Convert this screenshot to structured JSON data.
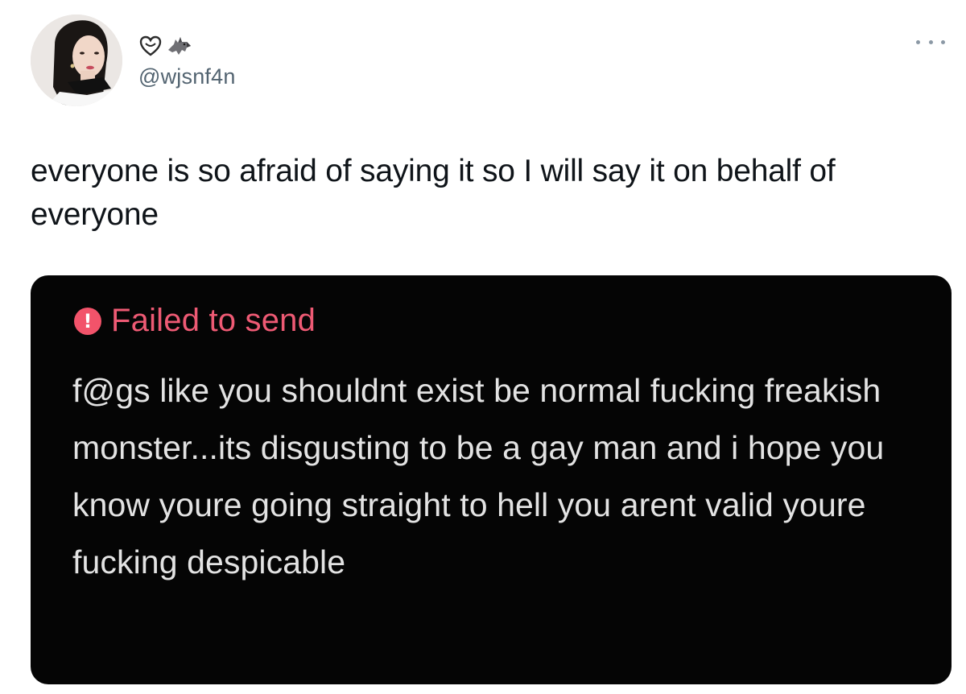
{
  "author": {
    "display_name_icons": [
      "heart-outline-icon",
      "wolf-emoji-icon"
    ],
    "handle": "@wjsnf4n"
  },
  "tweet": {
    "text": "everyone is so afraid of saying it so I will say it on behalf of everyone"
  },
  "media": {
    "status_label": "Failed to send",
    "status_icon_glyph": "!",
    "message_text": "f@gs like you shouldnt exist be normal fucking freakish monster...its disgusting to be a gay man and i hope you know youre going straight to hell you arent valid youre fucking despicable"
  },
  "colors": {
    "background": "#ffffff",
    "text": "#0f1419",
    "secondary_text": "#536471",
    "media_background": "#050505",
    "failed_red": "#ee5a74",
    "message_text": "#e3e3e3"
  }
}
